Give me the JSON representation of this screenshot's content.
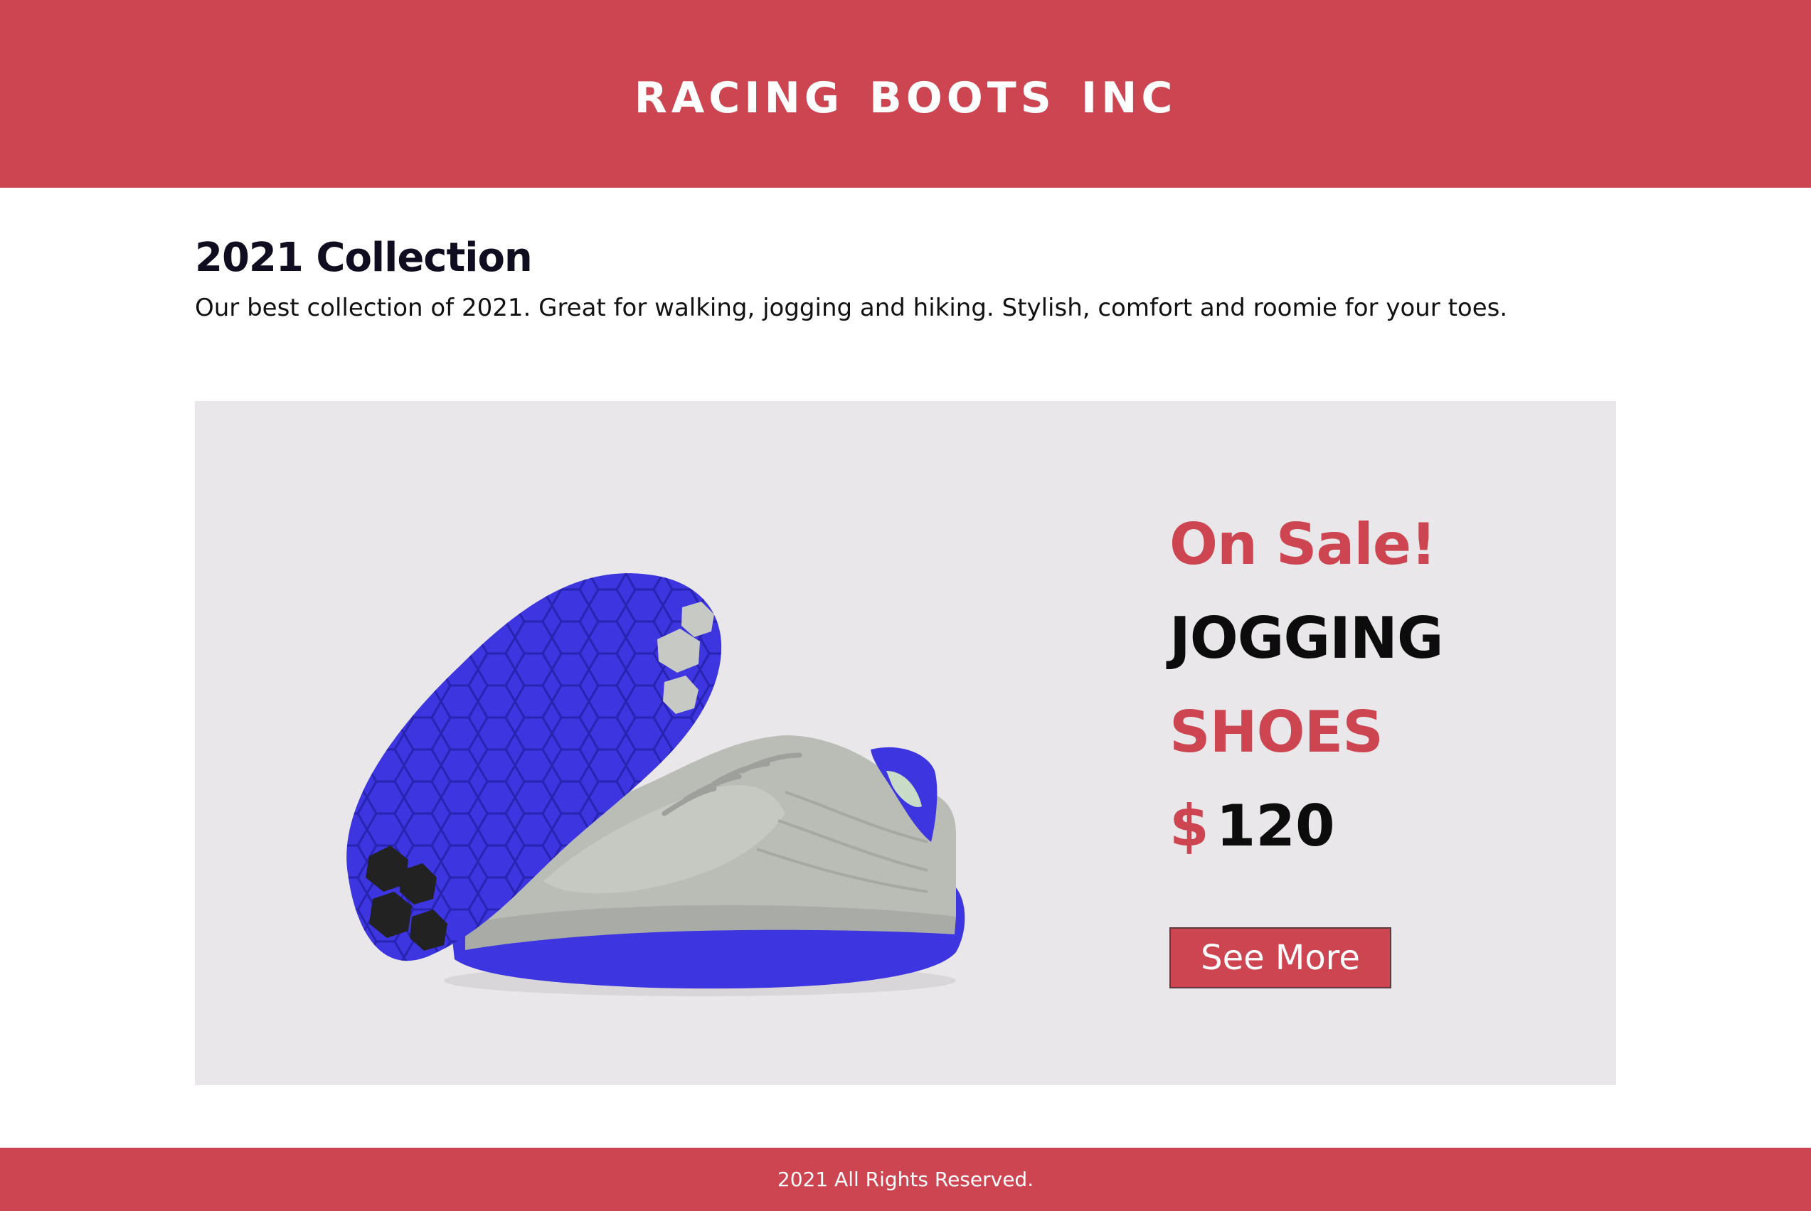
{
  "header": {
    "brand": "Racing Boots Inc"
  },
  "intro": {
    "title": "2021 Collection",
    "description": "Our best collection of 2021. Great for walking, jogging and hiking. Stylish, comfort and roomie for your toes."
  },
  "promo": {
    "badge": "On Sale!",
    "name_line1": "JOGGING",
    "name_line2": "SHOES",
    "currency": "$",
    "price": "120",
    "cta": "See More"
  },
  "footer": {
    "text": "2021 All Rights Reserved."
  },
  "colors": {
    "brand_red": "#cd4550",
    "card_bg": "#e9e7e9",
    "sole_blue": "#3c35e0",
    "upper_gray": "#b9bdb5"
  },
  "icons": {
    "product_image": "running-shoe-illustration"
  }
}
